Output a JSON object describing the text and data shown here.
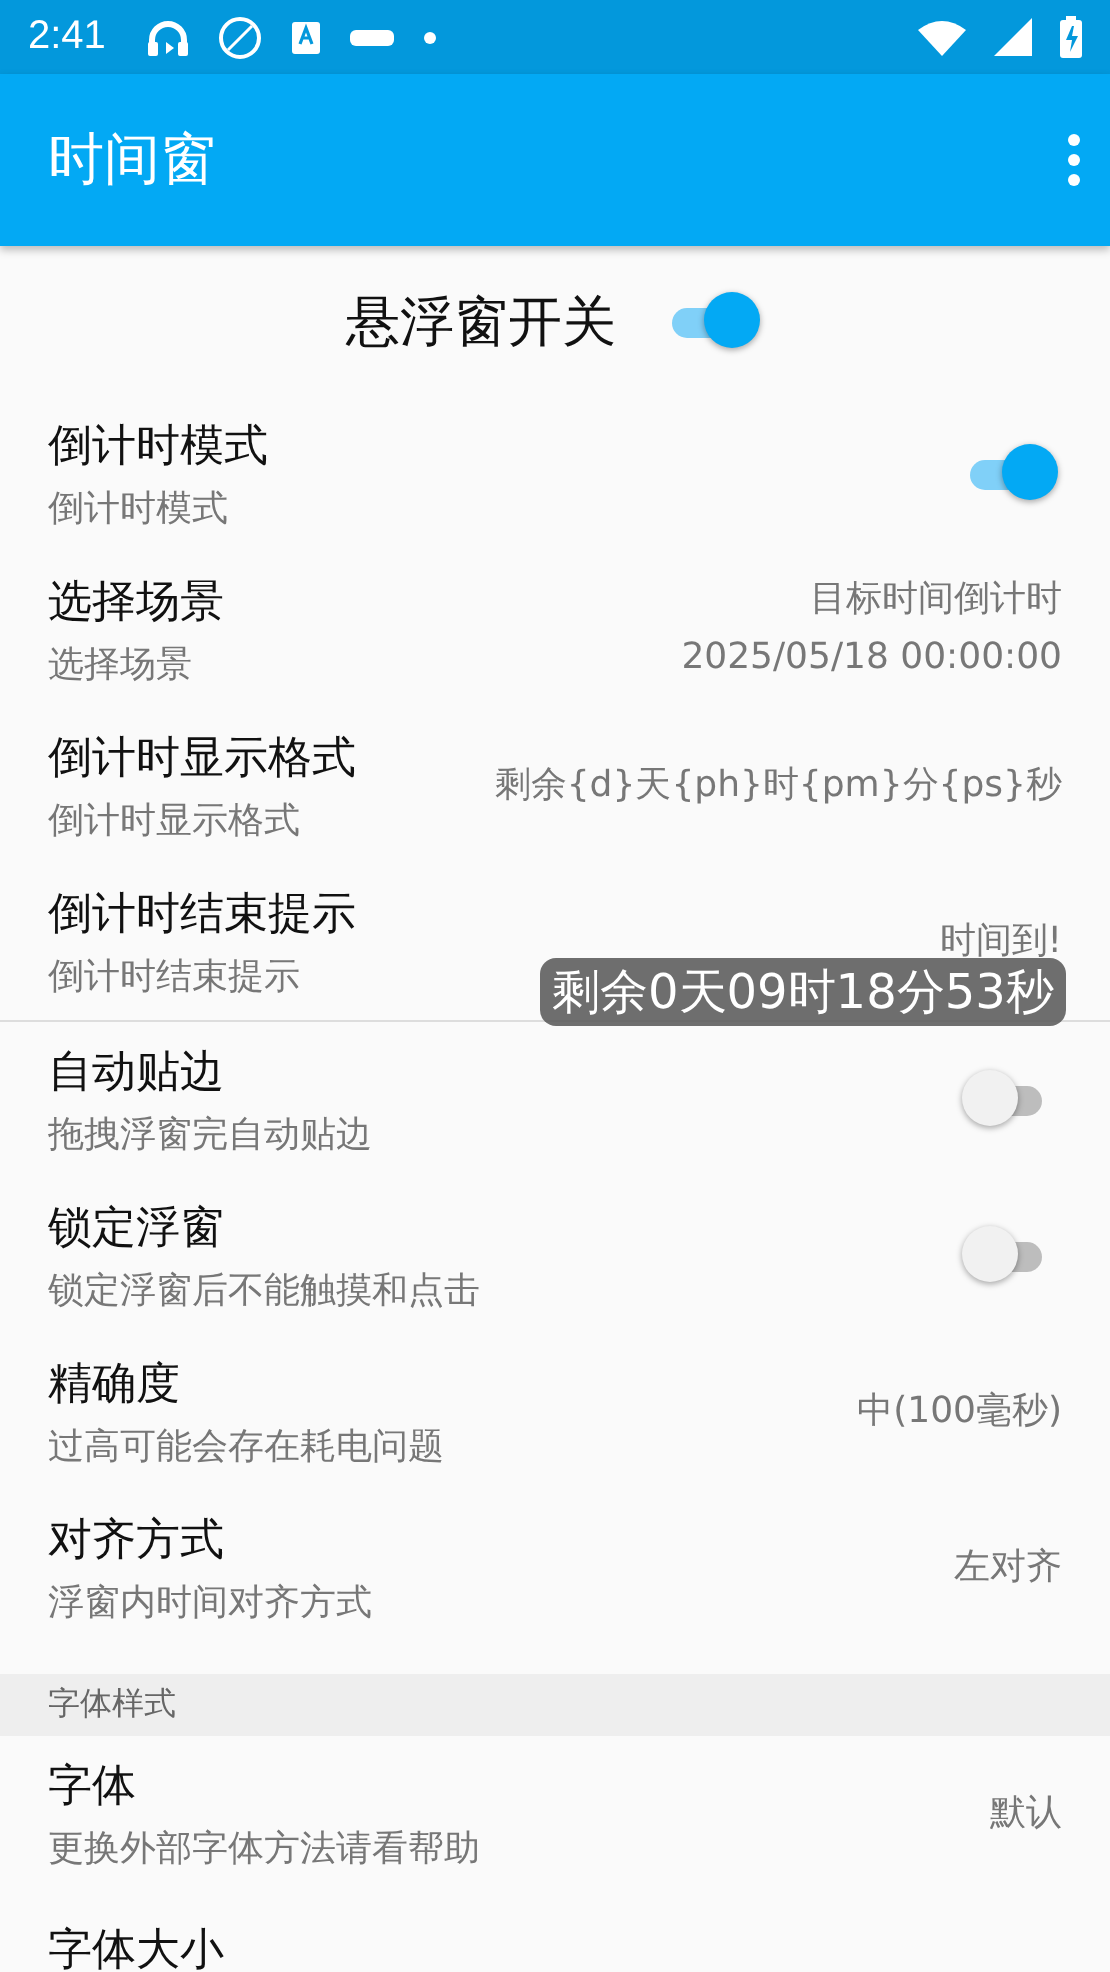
{
  "status_bar": {
    "time": "2:41"
  },
  "app_bar": {
    "title": "时间窗"
  },
  "master_switch": {
    "label": "悬浮窗开关",
    "on": true
  },
  "groups": [
    {
      "items": [
        {
          "kind": "switch",
          "title": "倒计时模式",
          "summary": "倒计时模式",
          "on": true
        },
        {
          "kind": "value",
          "title": "选择场景",
          "summary": "选择场景",
          "value": "目标时间倒计时\n2025/05/18 00:00:00"
        },
        {
          "kind": "value",
          "title": "倒计时显示格式",
          "summary": "倒计时显示格式",
          "value": "剩余{d}天{ph}时{pm}分{ps}秒"
        },
        {
          "kind": "value",
          "title": "倒计时结束提示",
          "summary": "倒计时结束提示",
          "value": "时间到!"
        }
      ]
    },
    {
      "items": [
        {
          "kind": "switch",
          "title": "自动贴边",
          "summary": "拖拽浮窗完自动贴边",
          "on": false
        },
        {
          "kind": "switch",
          "title": "锁定浮窗",
          "summary": "锁定浮窗后不能触摸和点击",
          "on": false
        },
        {
          "kind": "value",
          "title": "精确度",
          "summary": "过高可能会存在耗电问题",
          "value": "中(100毫秒)"
        },
        {
          "kind": "value",
          "title": "对齐方式",
          "summary": "浮窗内时间对齐方式",
          "value": "左对齐"
        }
      ]
    },
    {
      "header": "字体样式",
      "items": [
        {
          "kind": "value",
          "title": "字体",
          "summary": "更换外部字体方法请看帮助",
          "value": "默认"
        },
        {
          "kind": "title",
          "title": "字体大小"
        }
      ]
    }
  ],
  "floating_window": {
    "text": "剩余0天09时18分53秒"
  }
}
